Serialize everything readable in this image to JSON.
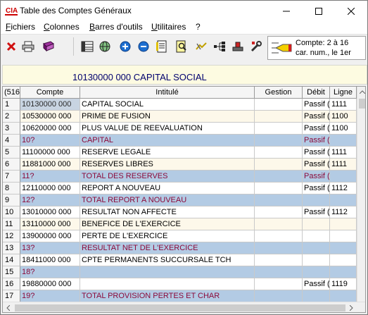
{
  "window": {
    "title": "Table des Comptes Généraux"
  },
  "menu": [
    {
      "label": "Fichiers",
      "mnemonic": "F",
      "rest": "ichiers"
    },
    {
      "label": "Colonnes",
      "mnemonic": "C",
      "rest": "olonnes"
    },
    {
      "label": "Barres d'outils",
      "mnemonic": "B",
      "rest": "arres d'outils"
    },
    {
      "label": "Utilitaires",
      "mnemonic": "U",
      "rest": "tilitaires"
    },
    {
      "label": "?",
      "mnemonic": "",
      "rest": "?"
    }
  ],
  "toolbar": {
    "icons": [
      "delete-icon",
      "print-icon",
      "book-icon",
      "table-icon",
      "globe-icon",
      "add-icon",
      "remove-icon",
      "edit-icon",
      "search-icon",
      "link-icon",
      "tree-icon",
      "stamp-icon",
      "tools-icon"
    ],
    "panel": {
      "line1": "Compte: 2 à 16",
      "line2": "car. num., le 1er"
    }
  },
  "banner": {
    "text": "10130000 000 CAPITAL SOCIAL"
  },
  "grid": {
    "columns": {
      "corner": "(516",
      "compte": "Compte",
      "intitule": "Intitulé",
      "gestion": "Gestion",
      "debit": "Débit",
      "ligne": "Ligne"
    },
    "rows": [
      {
        "n": "1",
        "compte": "10130000 000",
        "intitule": "CAPITAL SOCIAL",
        "gestion": "",
        "debit": "Passif (",
        "ligne": "1111",
        "kind": "odd"
      },
      {
        "n": "2",
        "compte": "10530000 000",
        "intitule": "PRIME DE FUSION",
        "gestion": "",
        "debit": "Passif (",
        "ligne": "1100",
        "kind": "even"
      },
      {
        "n": "3",
        "compte": "10620000 000",
        "intitule": "PLUS VALUE DE REEVALUATION",
        "gestion": "",
        "debit": "Passif (",
        "ligne": "1100",
        "kind": "odd"
      },
      {
        "n": "4",
        "compte": "10?",
        "intitule": "CAPITAL",
        "gestion": "",
        "debit": "Passif (",
        "ligne": "",
        "kind": "total"
      },
      {
        "n": "5",
        "compte": "11100000 000",
        "intitule": "RESERVE LEGALE",
        "gestion": "",
        "debit": "Passif (",
        "ligne": "1111",
        "kind": "odd"
      },
      {
        "n": "6",
        "compte": "11881000 000",
        "intitule": "RESERVES LIBRES",
        "gestion": "",
        "debit": "Passif (",
        "ligne": "1111",
        "kind": "even"
      },
      {
        "n": "7",
        "compte": "11?",
        "intitule": "TOTAL DES RESERVES",
        "gestion": "",
        "debit": "Passif (",
        "ligne": "",
        "kind": "total"
      },
      {
        "n": "8",
        "compte": "12110000 000",
        "intitule": "REPORT A NOUVEAU",
        "gestion": "",
        "debit": "Passif (",
        "ligne": "1112",
        "kind": "odd"
      },
      {
        "n": "9",
        "compte": "12?",
        "intitule": "TOTAL REPORT A NOUVEAU",
        "gestion": "",
        "debit": "",
        "ligne": "",
        "kind": "total"
      },
      {
        "n": "10",
        "compte": "13010000 000",
        "intitule": "RESULTAT NON AFFECTE",
        "gestion": "",
        "debit": "Passif (",
        "ligne": "1112",
        "kind": "odd"
      },
      {
        "n": "11",
        "compte": "13110000 000",
        "intitule": "BENEFICE DE L'EXERCICE",
        "gestion": "",
        "debit": "",
        "ligne": "",
        "kind": "even"
      },
      {
        "n": "12",
        "compte": "13900000 000",
        "intitule": "PERTE DE L'EXERCICE",
        "gestion": "",
        "debit": "",
        "ligne": "",
        "kind": "odd"
      },
      {
        "n": "13",
        "compte": "13?",
        "intitule": "RESULTAT NET DE L'EXERCICE",
        "gestion": "",
        "debit": "",
        "ligne": "",
        "kind": "total"
      },
      {
        "n": "14",
        "compte": "18411000 000",
        "intitule": "CPTE PERMANENTS SUCCURSALE TCH",
        "gestion": "",
        "debit": "",
        "ligne": "",
        "kind": "odd"
      },
      {
        "n": "15",
        "compte": "18?",
        "intitule": "",
        "gestion": "",
        "debit": "",
        "ligne": "",
        "kind": "total"
      },
      {
        "n": "16",
        "compte": "19880000 000",
        "intitule": "",
        "gestion": "",
        "debit": "Passif (",
        "ligne": "1119",
        "kind": "odd"
      },
      {
        "n": "17",
        "compte": "19?",
        "intitule": "TOTAL PROVISION PERTES ET CHAR",
        "gestion": "",
        "debit": "",
        "ligne": "",
        "kind": "total"
      }
    ]
  }
}
